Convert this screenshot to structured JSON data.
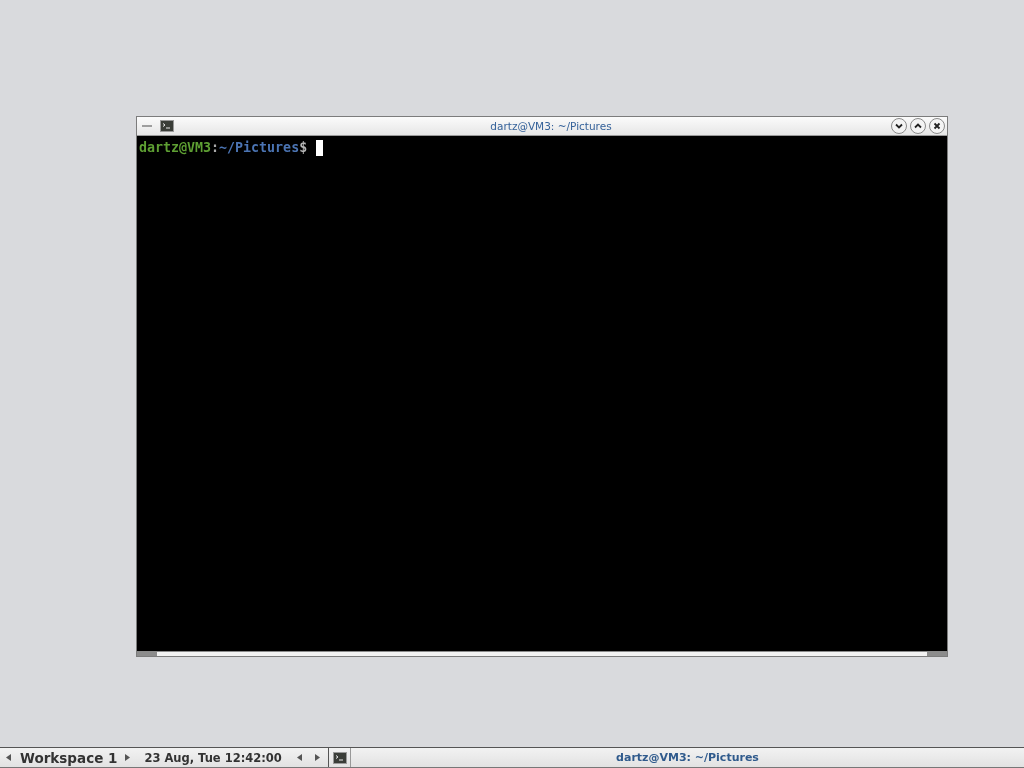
{
  "window": {
    "title": "dartz@VM3: ~/Pictures"
  },
  "terminal": {
    "prompt_user": "dartz@VM3",
    "prompt_separator": ":",
    "prompt_path": "~/Pictures",
    "prompt_symbol": "$"
  },
  "taskbar": {
    "workspace": "Workspace 1",
    "clock": "23 Aug, Tue 12:42:00",
    "tasks": [
      {
        "title": "dartz@VM3: ~/Pictures",
        "selected": true
      }
    ]
  }
}
